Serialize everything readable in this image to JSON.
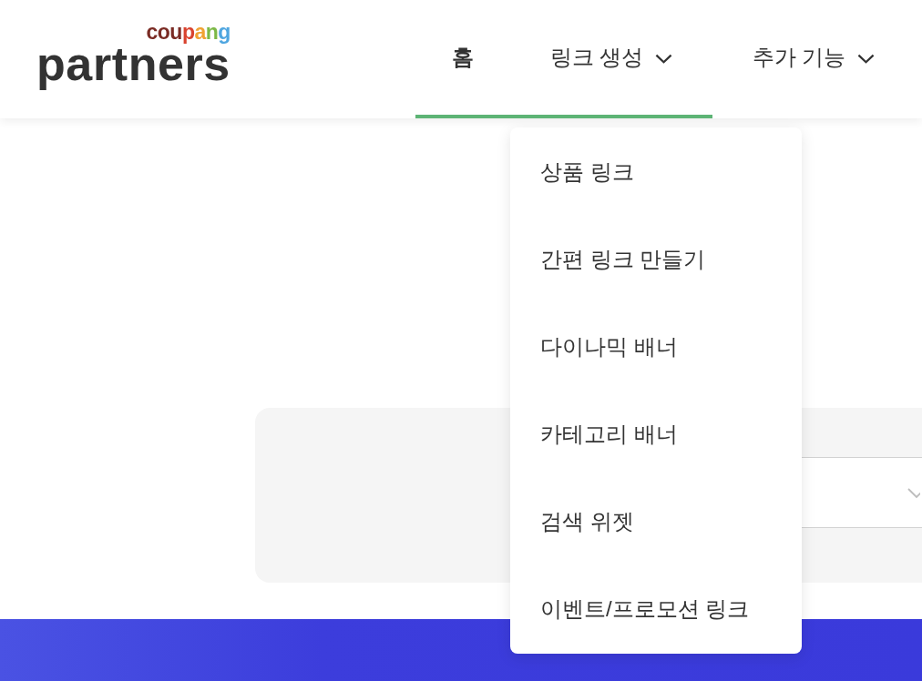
{
  "logo": {
    "top_text": "coupang",
    "main_text": "partners"
  },
  "nav": [
    {
      "label": "홈",
      "kind": "link",
      "selected": true,
      "expanded": false
    },
    {
      "label": "링크 생성",
      "kind": "menu",
      "selected": false,
      "expanded": true,
      "menu_items": [
        "상품 링크",
        "간편 링크 만들기",
        "다이나믹 배너",
        "카테고리 배너",
        "검색 위젯",
        "이벤트/프로모션 링크"
      ]
    },
    {
      "label": "추가 기능",
      "kind": "menu",
      "selected": false,
      "expanded": false
    }
  ]
}
